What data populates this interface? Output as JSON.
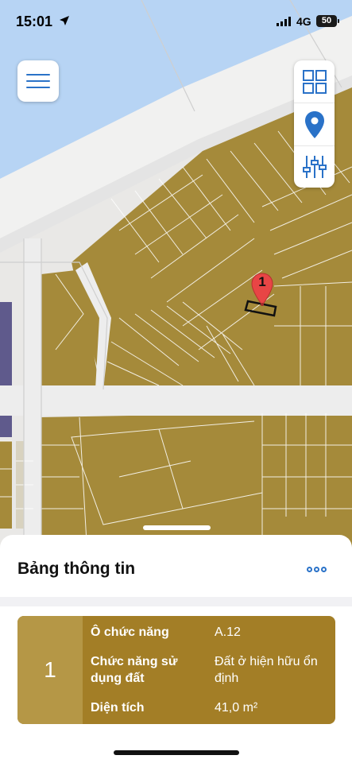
{
  "status_bar": {
    "time": "15:01",
    "network": "4G",
    "battery": "50"
  },
  "map": {
    "pin_number": "1",
    "water_color": "#b7d4f4",
    "parcel_color": "#a58a3a",
    "road_color": "#efefef"
  },
  "info_panel": {
    "title": "Bảng thông tin",
    "more_icon": "ellipsis-icon",
    "card": {
      "index": "1",
      "rows": [
        {
          "label": "Ô chức năng",
          "value": "A.12"
        },
        {
          "label": "Chức năng sử dụng đất",
          "value": "Đất ở hiện hữu ổn định"
        },
        {
          "label": "Diện tích",
          "value": "41,0 m²"
        }
      ]
    }
  }
}
